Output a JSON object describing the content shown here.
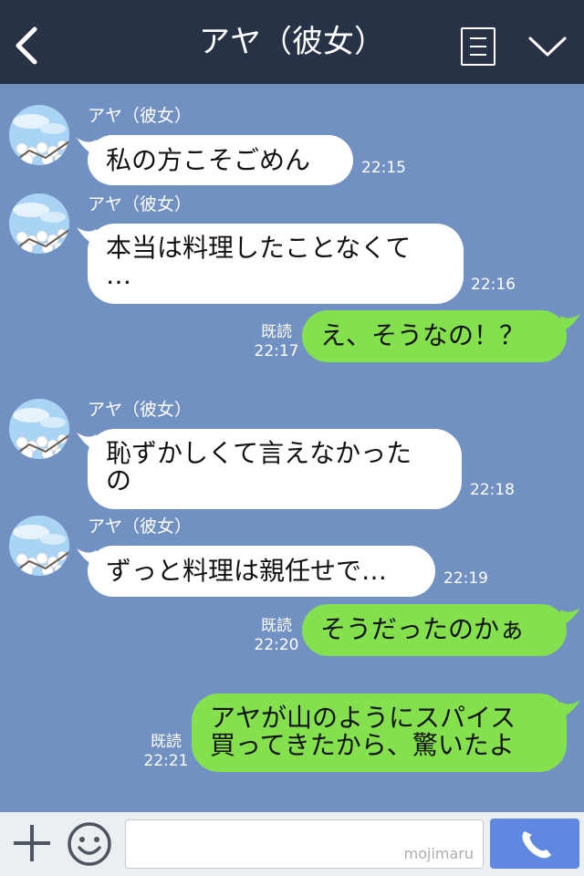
{
  "header": {
    "title": "アヤ（彼女）",
    "back_icon": "chevron-left-icon",
    "menu_icon": "menu-list-icon",
    "collapse_icon": "chevron-down-icon"
  },
  "messages": [
    {
      "sender": "アヤ（彼女）",
      "text": "私の方こそごめん",
      "time": "22:15"
    },
    {
      "sender": "アヤ（彼女）",
      "text": "本当は料理したことなくて\n…",
      "time": "22:16"
    },
    {
      "read": "既読",
      "text": "え、そうなの！？",
      "time": "22:17"
    },
    {
      "sender": "アヤ（彼女）",
      "text": "恥ずかしくて言えなかった\nの",
      "time": "22:18"
    },
    {
      "sender": "アヤ（彼女）",
      "text": "ずっと料理は親任せで…",
      "time": "22:19"
    },
    {
      "read": "既読",
      "text": "そうだったのかぁ",
      "time": "22:20"
    },
    {
      "read": "既読",
      "text": "アヤが山のようにスパイス\n買ってきたから、驚いたよ",
      "time": "22:21"
    }
  ],
  "footer": {
    "watermark": "mojimaru",
    "plus_icon": "plus-icon",
    "sticker_icon": "smiley-icon",
    "call_icon": "phone-icon"
  },
  "colors": {
    "header_bg": "#273246",
    "chat_bg": "#7191c3",
    "incoming_bubble": "#ffffff",
    "outgoing_bubble": "#84e14d",
    "call_button": "#5f88e0"
  }
}
